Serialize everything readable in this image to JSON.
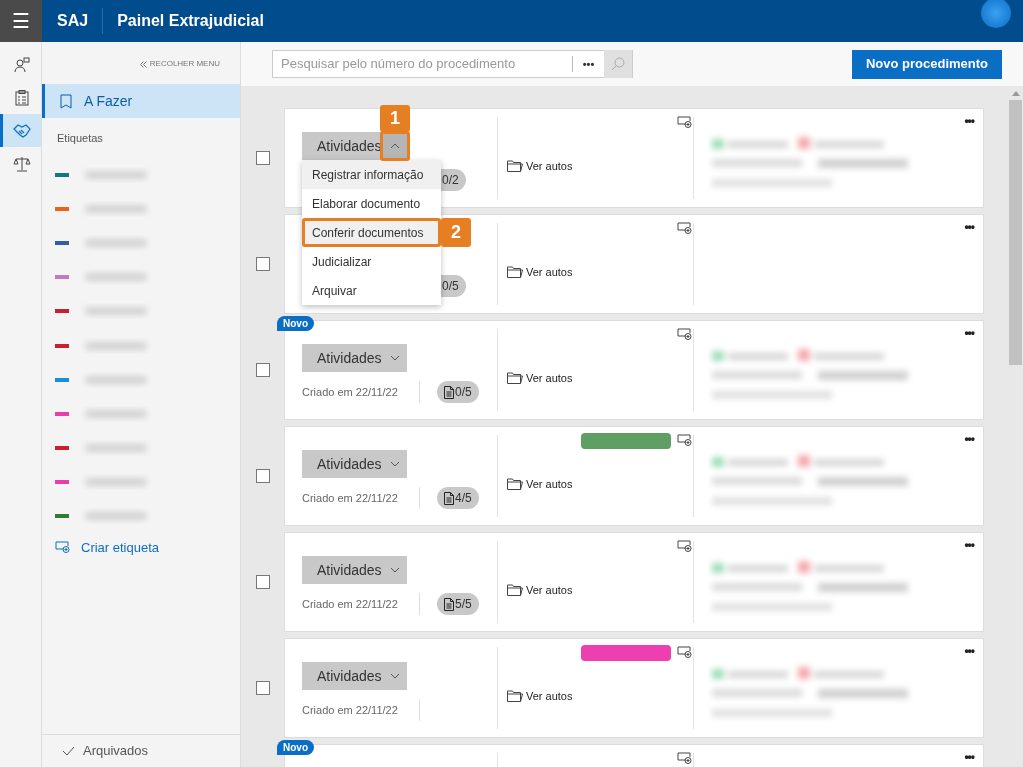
{
  "header": {
    "menu": "☰",
    "brand": "SAJ",
    "title": "Painel Extrajudicial"
  },
  "rail": [
    {
      "kind": "person",
      "selected": false
    },
    {
      "kind": "clipboard",
      "selected": false
    },
    {
      "kind": "handshake",
      "selected": true
    },
    {
      "kind": "scales",
      "selected": false
    }
  ],
  "sidebar": {
    "collapse": "RECOLHER MENU",
    "items": [
      {
        "label": "A Fazer",
        "selected": true
      }
    ],
    "tags_heading": "Etiquetas",
    "tags": [
      {
        "color": "#0e7a84"
      },
      {
        "color": "#e8641b"
      },
      {
        "color": "#2e5fa8"
      },
      {
        "color": "#c27bb9"
      },
      {
        "color": "#c8202f"
      },
      {
        "color": "#c8202f"
      },
      {
        "color": "#1a8fd9"
      },
      {
        "color": "#e83dab"
      },
      {
        "color": "#c8202f"
      },
      {
        "color": "#e83dab"
      },
      {
        "color": "#2e7d32"
      }
    ],
    "create_tag": "Criar etiqueta",
    "archived": "Arquivados"
  },
  "toolbar": {
    "search": {
      "placeholder": "Pesquisar pelo número do procedimento"
    },
    "more": "•••",
    "new_button": "Novo procedimento"
  },
  "cards": [
    {
      "checked": false,
      "activities": "Atividades",
      "expanded": true,
      "callout": "1",
      "counter": "0/2",
      "doc_icon": false,
      "link": "Ver autos",
      "more": "•••",
      "menu": [
        {
          "label": "Registrar informação",
          "highlighted": true
        },
        {
          "label": "Elaborar documento",
          "highlighted": false
        },
        {
          "label": "Conferir documentos",
          "highlighted": true,
          "callout": "2"
        },
        {
          "label": "Judicializar",
          "highlighted": false
        },
        {
          "label": "Arquivar",
          "highlighted": false
        }
      ]
    },
    {
      "checked": false,
      "counter": "0/5",
      "doc_icon": false,
      "link": "Ver autos",
      "more": "•••"
    },
    {
      "checked": false,
      "badge": "Novo",
      "activities": "Atividades",
      "expanded": false,
      "created": "Criado em 22/11/22",
      "counter": "0/5",
      "doc_icon": true,
      "link": "Ver autos",
      "more": "•••"
    },
    {
      "checked": false,
      "activities": "Atividades",
      "expanded": false,
      "created": "Criado em 22/11/22",
      "counter": "4/5",
      "doc_icon": true,
      "link": "Ver autos",
      "more": "•••",
      "tag": {
        "color": "#5f9f63"
      }
    },
    {
      "checked": false,
      "activities": "Atividades",
      "expanded": false,
      "created": "Criado em 22/11/22",
      "counter": "5/5",
      "doc_icon": true,
      "link": "Ver autos",
      "more": "•••"
    },
    {
      "checked": false,
      "activities": "Atividades",
      "expanded": false,
      "created": "Criado em 22/11/22",
      "link": "Ver autos",
      "more": "•••",
      "tag": {
        "color": "#ee3fb0"
      }
    },
    {
      "badge": "Novo",
      "more": "•••"
    }
  ]
}
